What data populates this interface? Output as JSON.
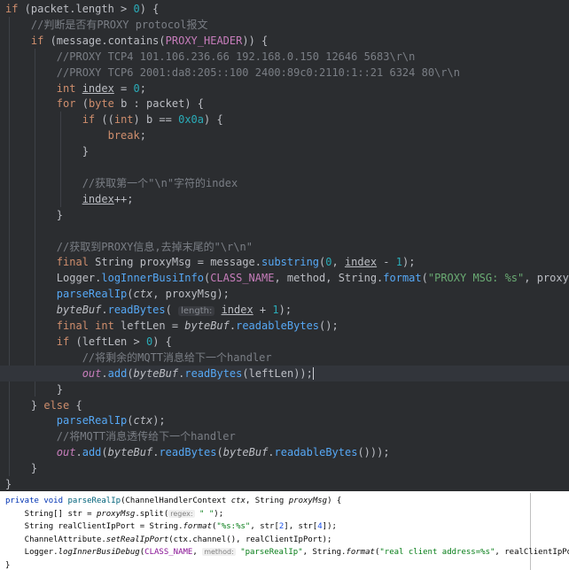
{
  "top_editor": {
    "lines": [
      [
        [
          "kw",
          "if"
        ],
        [
          "plain",
          " (packet.length > "
        ],
        [
          "num",
          "0"
        ],
        [
          "plain",
          ") {"
        ]
      ],
      [
        [
          "cmt",
          "    //判断是否有PROXY protocol报文"
        ]
      ],
      [
        [
          "kw",
          "    if"
        ],
        [
          "plain",
          " (message.contains("
        ],
        [
          "const",
          "PROXY_HEADER"
        ],
        [
          "plain",
          ")) {"
        ]
      ],
      [
        [
          "cmt",
          "        //PROXY TCP4 101.106.236.66 192.168.0.150 12646 5683\\r\\n"
        ]
      ],
      [
        [
          "cmt",
          "        //PROXY TCP6 2001:da8:205::100 2400:89c0:2110:1::21 6324 80\\r\\n"
        ]
      ],
      [
        [
          "kw",
          "        int "
        ],
        [
          "under",
          "index"
        ],
        [
          "plain",
          " = "
        ],
        [
          "num",
          "0"
        ],
        [
          "plain",
          ";"
        ]
      ],
      [
        [
          "kw",
          "        for"
        ],
        [
          "plain",
          " ("
        ],
        [
          "kw",
          "byte"
        ],
        [
          "plain",
          " b : packet) {"
        ]
      ],
      [
        [
          "kw",
          "            if"
        ],
        [
          "plain",
          " (("
        ],
        [
          "kw",
          "int"
        ],
        [
          "plain",
          ") b == "
        ],
        [
          "num",
          "0x0a"
        ],
        [
          "plain",
          ") {"
        ]
      ],
      [
        [
          "kw",
          "                break"
        ],
        [
          "plain",
          ";"
        ]
      ],
      [
        [
          "plain",
          "            }"
        ]
      ],
      [
        [
          "plain",
          ""
        ]
      ],
      [
        [
          "cmt",
          "            //获取第一个\"\\n\"字符的index"
        ]
      ],
      [
        [
          "plain",
          "            "
        ],
        [
          "under",
          "index"
        ],
        [
          "plain",
          "++;"
        ]
      ],
      [
        [
          "plain",
          "        }"
        ]
      ],
      [
        [
          "plain",
          ""
        ]
      ],
      [
        [
          "cmt",
          "        //获取到PROXY信息,去掉末尾的\"\\r\\n\""
        ]
      ],
      [
        [
          "kw",
          "        final "
        ],
        [
          "plain",
          "String proxyMsg = message."
        ],
        [
          "fn",
          "substring"
        ],
        [
          "plain",
          "("
        ],
        [
          "num",
          "0"
        ],
        [
          "plain",
          ", "
        ],
        [
          "under",
          "index"
        ],
        [
          "plain",
          " - "
        ],
        [
          "num",
          "1"
        ],
        [
          "plain",
          ");"
        ]
      ],
      [
        [
          "plain",
          "        Logger."
        ],
        [
          "fn",
          "logInnerBusiInfo"
        ],
        [
          "plain",
          "("
        ],
        [
          "const",
          "CLASS_NAME"
        ],
        [
          "plain",
          ", method, String."
        ],
        [
          "fn",
          "format"
        ],
        [
          "plain",
          "("
        ],
        [
          "str",
          "\"PROXY MSG: %s\""
        ],
        [
          "plain",
          ", proxyMsg);"
        ]
      ],
      [
        [
          "plain",
          "        "
        ],
        [
          "fn",
          "parseRealIp"
        ],
        [
          "plain",
          "("
        ],
        [
          "italic",
          "ctx"
        ],
        [
          "plain",
          ", proxyMsg);"
        ]
      ],
      [
        [
          "plain",
          "        "
        ],
        [
          "italic",
          "byteBuf"
        ],
        [
          "plain",
          "."
        ],
        [
          "fn",
          "readBytes"
        ],
        [
          "plain",
          "( "
        ],
        [
          "hint",
          "length:"
        ],
        [
          "plain",
          " "
        ],
        [
          "under",
          "index"
        ],
        [
          "plain",
          " + "
        ],
        [
          "num",
          "1"
        ],
        [
          "plain",
          ");"
        ]
      ],
      [
        [
          "kw",
          "        final int "
        ],
        [
          "plain",
          "leftLen = "
        ],
        [
          "italic",
          "byteBuf"
        ],
        [
          "plain",
          "."
        ],
        [
          "fn",
          "readableBytes"
        ],
        [
          "plain",
          "();"
        ]
      ],
      [
        [
          "kw",
          "        if"
        ],
        [
          "plain",
          " (leftLen > "
        ],
        [
          "num",
          "0"
        ],
        [
          "plain",
          ") {"
        ]
      ],
      [
        [
          "cmt",
          "            //将剩余的MQTT消息给下一个handler"
        ]
      ],
      [
        [
          "plain",
          "            "
        ],
        [
          "static",
          "out"
        ],
        [
          "plain",
          "."
        ],
        [
          "fn",
          "add"
        ],
        [
          "plain",
          "("
        ],
        [
          "italic",
          "byteBuf"
        ],
        [
          "plain",
          "."
        ],
        [
          "fn",
          "readBytes"
        ],
        [
          "plain",
          "(leftLen));"
        ],
        [
          "caret",
          ""
        ]
      ],
      [
        [
          "plain",
          "        }"
        ]
      ],
      [
        [
          "plain",
          "    } "
        ],
        [
          "kw",
          "else"
        ],
        [
          "plain",
          " {"
        ]
      ],
      [
        [
          "plain",
          "        "
        ],
        [
          "fn",
          "parseRealIp"
        ],
        [
          "plain",
          "("
        ],
        [
          "italic",
          "ctx"
        ],
        [
          "plain",
          ");"
        ]
      ],
      [
        [
          "cmt",
          "        //将MQTT消息透传给下一个handler"
        ]
      ],
      [
        [
          "plain",
          "        "
        ],
        [
          "static",
          "out"
        ],
        [
          "plain",
          "."
        ],
        [
          "fn",
          "add"
        ],
        [
          "plain",
          "("
        ],
        [
          "italic",
          "byteBuf"
        ],
        [
          "plain",
          "."
        ],
        [
          "fn",
          "readBytes"
        ],
        [
          "plain",
          "("
        ],
        [
          "italic",
          "byteBuf"
        ],
        [
          "plain",
          "."
        ],
        [
          "fn",
          "readableBytes"
        ],
        [
          "plain",
          "()));"
        ]
      ],
      [
        [
          "plain",
          "    }"
        ]
      ],
      [
        [
          "plain",
          "}"
        ]
      ]
    ]
  },
  "bottom_editor": {
    "lines": [
      [
        [
          "kw",
          "private void "
        ],
        [
          "fn",
          "parseRealIp"
        ],
        [
          "plain",
          "(ChannelHandlerContext "
        ],
        [
          "param",
          "ctx"
        ],
        [
          "plain",
          ", String "
        ],
        [
          "param",
          "proxyMsg"
        ],
        [
          "plain",
          ") {"
        ]
      ],
      [
        [
          "plain",
          "    String[] "
        ],
        [
          "plain",
          "str = "
        ],
        [
          "param",
          "proxyMsg"
        ],
        [
          "plain",
          "."
        ],
        [
          "plain",
          "split("
        ],
        [
          "hint",
          "regex:"
        ],
        [
          "str",
          " \" \""
        ],
        [
          "plain",
          ");"
        ]
      ],
      [
        [
          "plain",
          "    String realClientIpPort = String."
        ],
        [
          "static",
          "format"
        ],
        [
          "plain",
          "("
        ],
        [
          "str",
          "\"%s:%s\""
        ],
        [
          "plain",
          ", str["
        ],
        [
          "num",
          "2"
        ],
        [
          "plain",
          "], str["
        ],
        [
          "num",
          "4"
        ],
        [
          "plain",
          "]);"
        ]
      ],
      [
        [
          "plain",
          "    ChannelAttribute."
        ],
        [
          "static",
          "setRealIpPort"
        ],
        [
          "plain",
          "(ctx.channel(), realClientIpPort);"
        ]
      ],
      [
        [
          "plain",
          "    Logger."
        ],
        [
          "static",
          "logInnerBusiDebug"
        ],
        [
          "plain",
          "("
        ],
        [
          "const",
          "CLASS_NAME"
        ],
        [
          "plain",
          ", "
        ],
        [
          "hint",
          "method:"
        ],
        [
          "str",
          " \"parseRealIp\""
        ],
        [
          "plain",
          ", String."
        ],
        [
          "static",
          "format"
        ],
        [
          "plain",
          "("
        ],
        [
          "str",
          "\"real client address=%s\""
        ],
        [
          "plain",
          ", realClientIpPort));"
        ]
      ],
      [
        [
          "plain",
          "}"
        ]
      ]
    ]
  }
}
